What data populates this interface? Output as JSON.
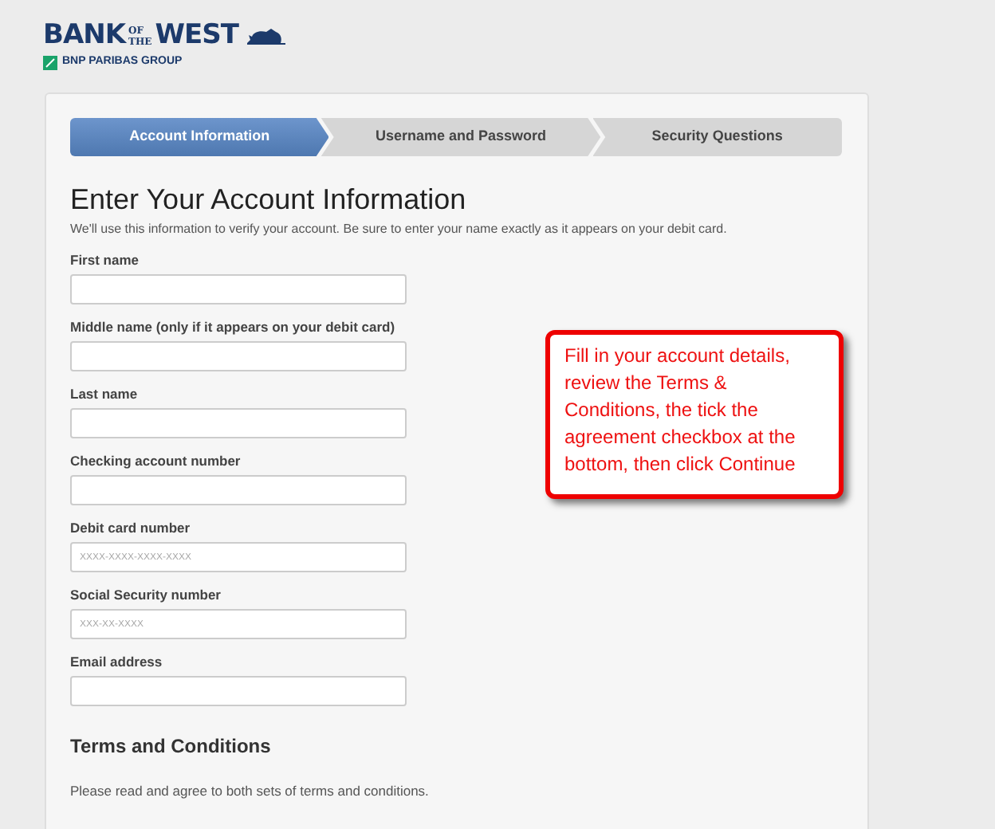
{
  "logo": {
    "words": [
      "BANK",
      "OF",
      "THE",
      "WEST"
    ],
    "group": "BNP PARIBAS GROUP"
  },
  "steps": [
    {
      "label": "Account Information",
      "selected": true
    },
    {
      "label": "Username and Password",
      "selected": false
    },
    {
      "label": "Security Questions",
      "selected": false
    }
  ],
  "heading": "Enter Your Account Information",
  "intro": "We'll use this information to verify your account. Be sure to enter your name exactly as it appears on your debit card.",
  "fields": [
    {
      "label": "First name"
    },
    {
      "label": "Middle name (only if it appears on your debit card)"
    },
    {
      "label": "Last name"
    },
    {
      "label": "Checking account number"
    },
    {
      "label": "Debit card number",
      "placeholder": "XXXX-XXXX-XXXX-XXXX"
    },
    {
      "label": "Social Security number",
      "placeholder": "XXX-XX-XXXX"
    },
    {
      "label": "Email address"
    }
  ],
  "terms": {
    "title": "Terms and Conditions",
    "text": "Please read and agree to both sets of terms and conditions."
  },
  "callout": "Fill in your account details, review the Terms & Conditions, the tick the agreement checkbox at the bottom, then click Continue"
}
